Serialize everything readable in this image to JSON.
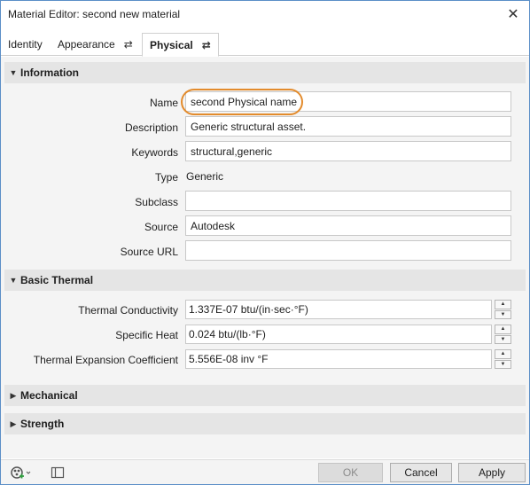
{
  "window": {
    "title": "Material Editor: second new material"
  },
  "tabs": [
    {
      "label": "Identity"
    },
    {
      "label": "Appearance"
    },
    {
      "label": "Physical"
    }
  ],
  "swap_glyph": "⇄",
  "information": {
    "heading": "Information",
    "name_label": "Name",
    "name_value": "second Physical name",
    "description_label": "Description",
    "description_value": "Generic structural asset.",
    "keywords_label": "Keywords",
    "keywords_value": "structural,generic",
    "type_label": "Type",
    "type_value": "Generic",
    "subclass_label": "Subclass",
    "subclass_value": "",
    "source_label": "Source",
    "source_value": "Autodesk",
    "source_url_label": "Source URL",
    "source_url_value": ""
  },
  "basic_thermal": {
    "heading": "Basic Thermal",
    "conductivity_label": "Thermal Conductivity",
    "conductivity_value": "1.337E-07 btu/(in·sec·°F)",
    "specific_heat_label": "Specific Heat",
    "specific_heat_value": "0.024 btu/(lb·°F)",
    "expansion_label": "Thermal Expansion Coefficient",
    "expansion_value": "5.556E-08 inv °F"
  },
  "mechanical": {
    "heading": "Mechanical"
  },
  "strength": {
    "heading": "Strength"
  },
  "footer": {
    "ok_label": "OK",
    "cancel_label": "Cancel",
    "apply_label": "Apply"
  },
  "colors": {
    "window_border": "#5b8fc7",
    "highlight": "#e38b2c",
    "section_header": "#e5e5e5",
    "panel_background": "#f4f4f4"
  }
}
